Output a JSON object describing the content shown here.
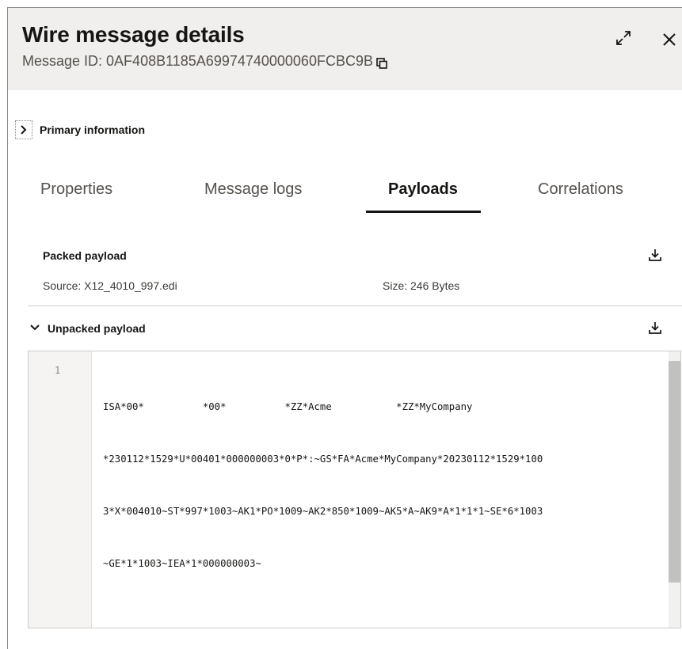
{
  "header": {
    "title": "Wire message details",
    "message_id_label": "Message ID: 0AF408B1185A69974740000060FCBC9B"
  },
  "primary": {
    "label": "Primary information"
  },
  "tabs": [
    {
      "label": "Properties",
      "active": false
    },
    {
      "label": "Message logs",
      "active": false
    },
    {
      "label": "Payloads",
      "active": true
    },
    {
      "label": "Correlations",
      "active": false
    }
  ],
  "packed": {
    "title": "Packed payload",
    "source": "Source: X12_4010_997.edi",
    "size": "Size: 246 Bytes"
  },
  "unpacked": {
    "title": "Unpacked payload",
    "line_number": "1",
    "lines": [
      "ISA*00*          *00*          *ZZ*Acme           *ZZ*MyCompany",
      "*230112*1529*U*00401*000000003*0*P*:~GS*FA*Acme*MyCompany*20230112*1529*100",
      "3*X*004010~ST*997*1003~AK1*PO*1009~AK2*850*1009~AK5*A~AK9*A*1*1*1~SE*6*1003",
      "~GE*1*1003~IEA*1*000000003~"
    ]
  },
  "icons": {
    "copy": "copy-icon",
    "expand": "expand-icon",
    "close": "close-icon",
    "chevron_right": "chevron-right-icon",
    "chevron_down": "chevron-down-icon",
    "download": "download-icon"
  },
  "colors": {
    "header_bg": "#f1efed",
    "active_tab": "#161513",
    "muted_text": "#55514d"
  }
}
